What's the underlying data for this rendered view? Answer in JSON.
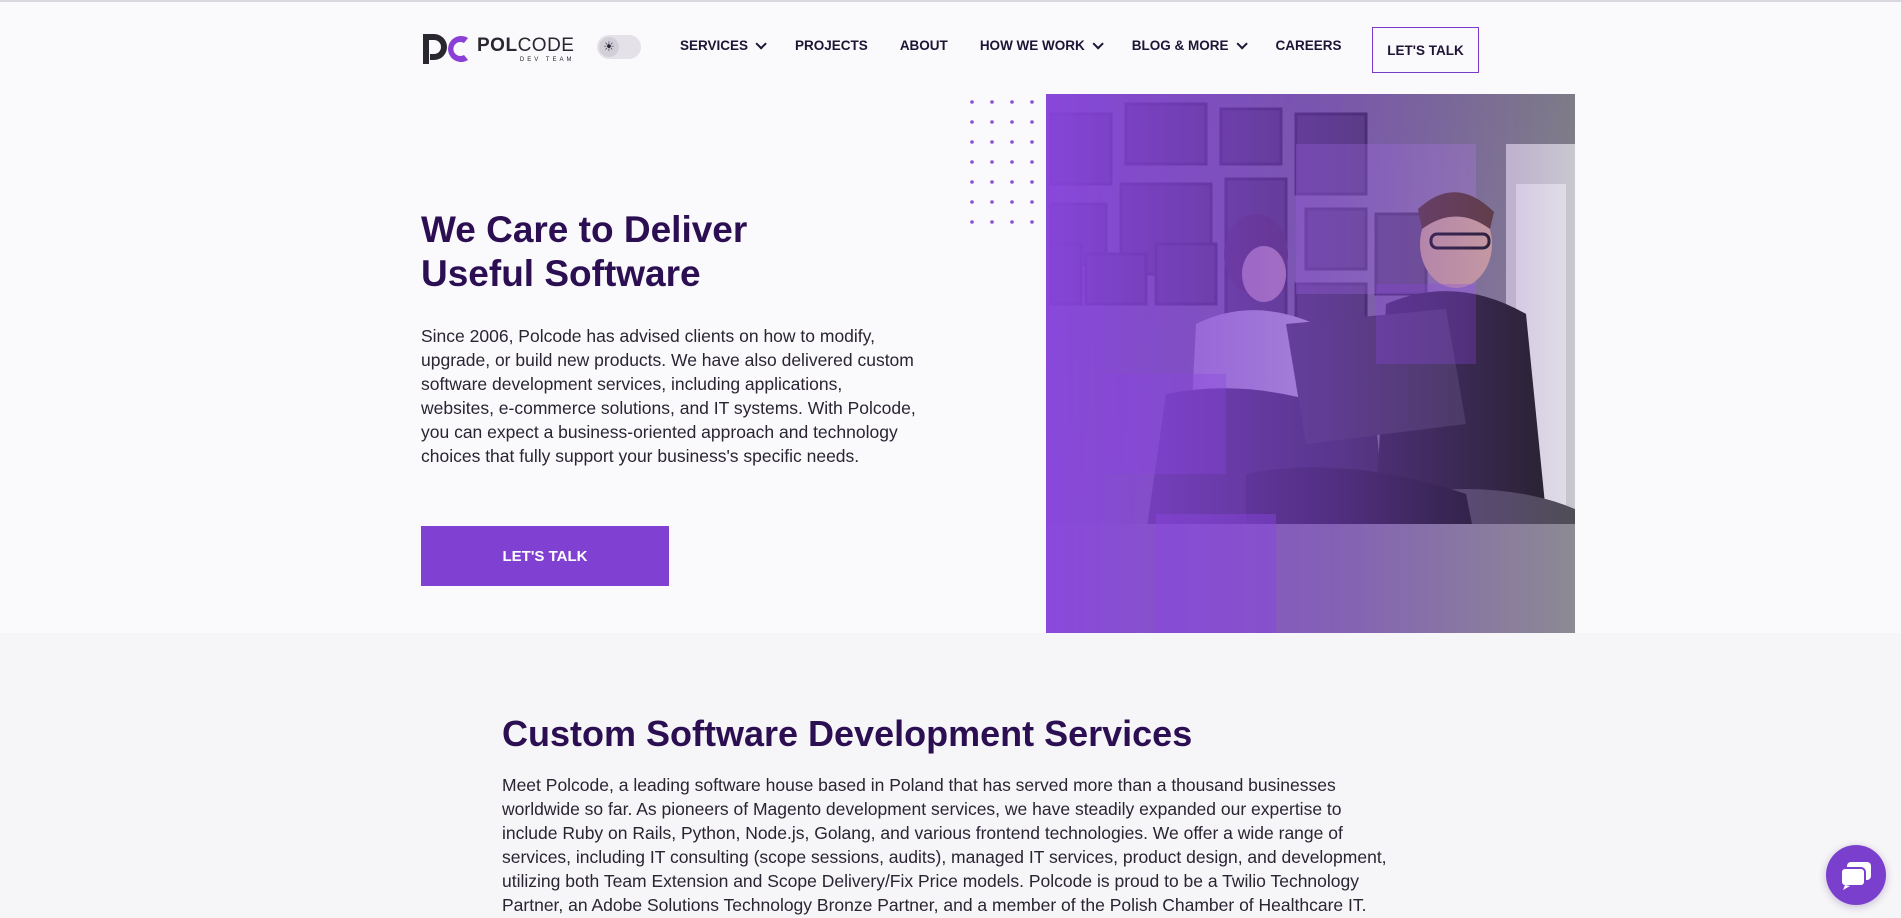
{
  "header": {
    "logo": {
      "word_bold": "POL",
      "word_light": "CODE",
      "sub": "DEV TEAM"
    },
    "theme_toggle_icon": "sun-icon",
    "nav": [
      {
        "label": "SERVICES",
        "has_dropdown": true
      },
      {
        "label": "PROJECTS",
        "has_dropdown": false
      },
      {
        "label": "ABOUT",
        "has_dropdown": false
      },
      {
        "label": "HOW WE WORK",
        "has_dropdown": true
      },
      {
        "label": "BLOG & MORE",
        "has_dropdown": true
      },
      {
        "label": "CAREERS",
        "has_dropdown": false
      }
    ],
    "cta_label": "LET'S TALK"
  },
  "hero": {
    "title_line1": "We Care to Deliver",
    "title_line2": "Useful Software",
    "text": "Since 2006, Polcode has advised clients on how to modify, upgrade, or build new products. We have also delivered custom software development services, including applications, websites, e-commerce solutions, and IT systems. With Polcode, you can expect a business-oriented approach and technology choices that fully support your business's specific needs.",
    "button_label": "LET'S TALK"
  },
  "services": {
    "title": "Custom Software Development Services",
    "text": "Meet Polcode, a leading software house based in Poland that has served more than a thousand businesses worldwide so far. As pioneers of Magento development services, we have steadily expanded our expertise to include Ruby on Rails, Python, Node.js, Golang, and various frontend technologies. We offer a wide range of services, including IT consulting (scope sessions, audits), managed IT services, product design, and development, utilizing both Team Extension and Scope Delivery/Fix Price models. Polcode is proud to be a Twilio Technology Partner, an Adobe Solutions Technology Bronze Partner, and a member of the Polish Chamber of Healthcare IT."
  },
  "chat_icon": "chat-bubble-icon",
  "colors": {
    "brand_purple": "#8040d1",
    "heading_navy": "#2b0f52",
    "nav_text": "#1d1436"
  }
}
